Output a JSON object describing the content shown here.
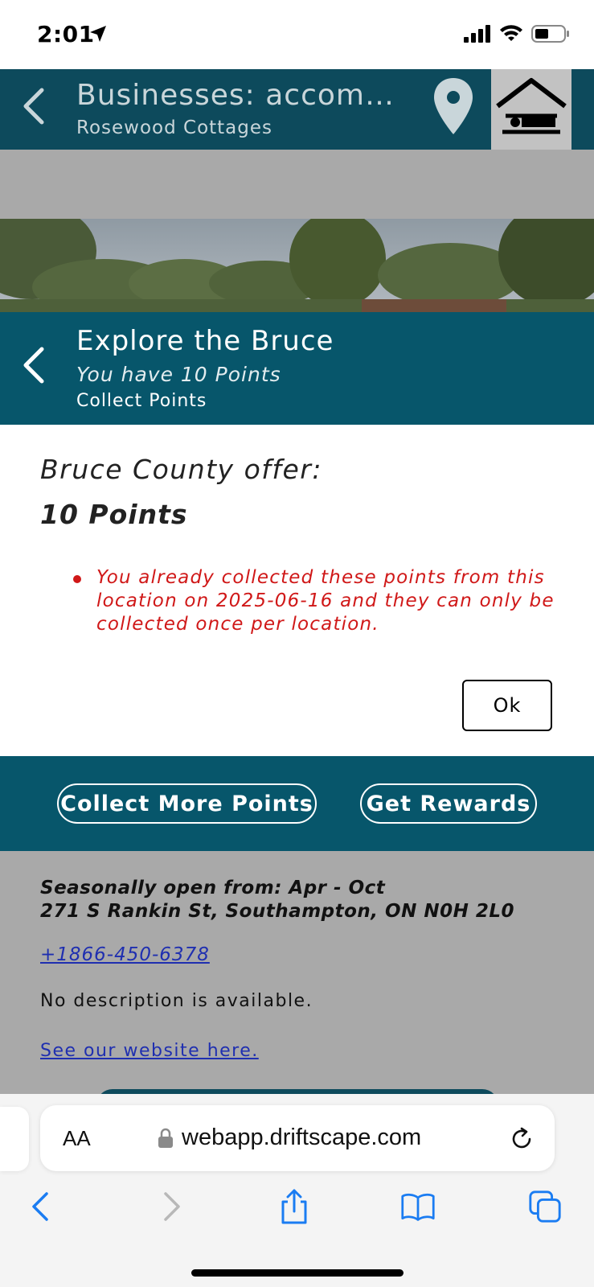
{
  "status_bar": {
    "time": "2:01"
  },
  "app_header": {
    "title": "Businesses: accommo...",
    "subtitle": "Rosewood Cottages"
  },
  "background": {
    "address_line1": "Seasonally open from: Apr - Oct",
    "address_line2": "271 S Rankin St, Southampton, ON N0H 2L0",
    "phone": "+1866-450-6378",
    "description": "No description is available.",
    "website_link": "See our website here."
  },
  "modal": {
    "title": "Explore the Bruce",
    "points_status": "You have 10 Points",
    "section": "Collect Points",
    "offer_label": "Bruce County offer:",
    "offer_points": "10 Points",
    "error_message": "You already collected these points from this location on 2025-06-16 and they can only be collected once per location.",
    "ok_label": "Ok",
    "collect_more_label": "Collect More Points",
    "get_rewards_label": "Get Rewards"
  },
  "browser": {
    "aa_label": "AA",
    "url": "webapp.driftscape.com"
  },
  "colors": {
    "header_bg": "#0d4a5c",
    "modal_bg": "#07566b",
    "error": "#d01818",
    "link": "#1f2fb0",
    "overlay": "#a9a9a9"
  }
}
